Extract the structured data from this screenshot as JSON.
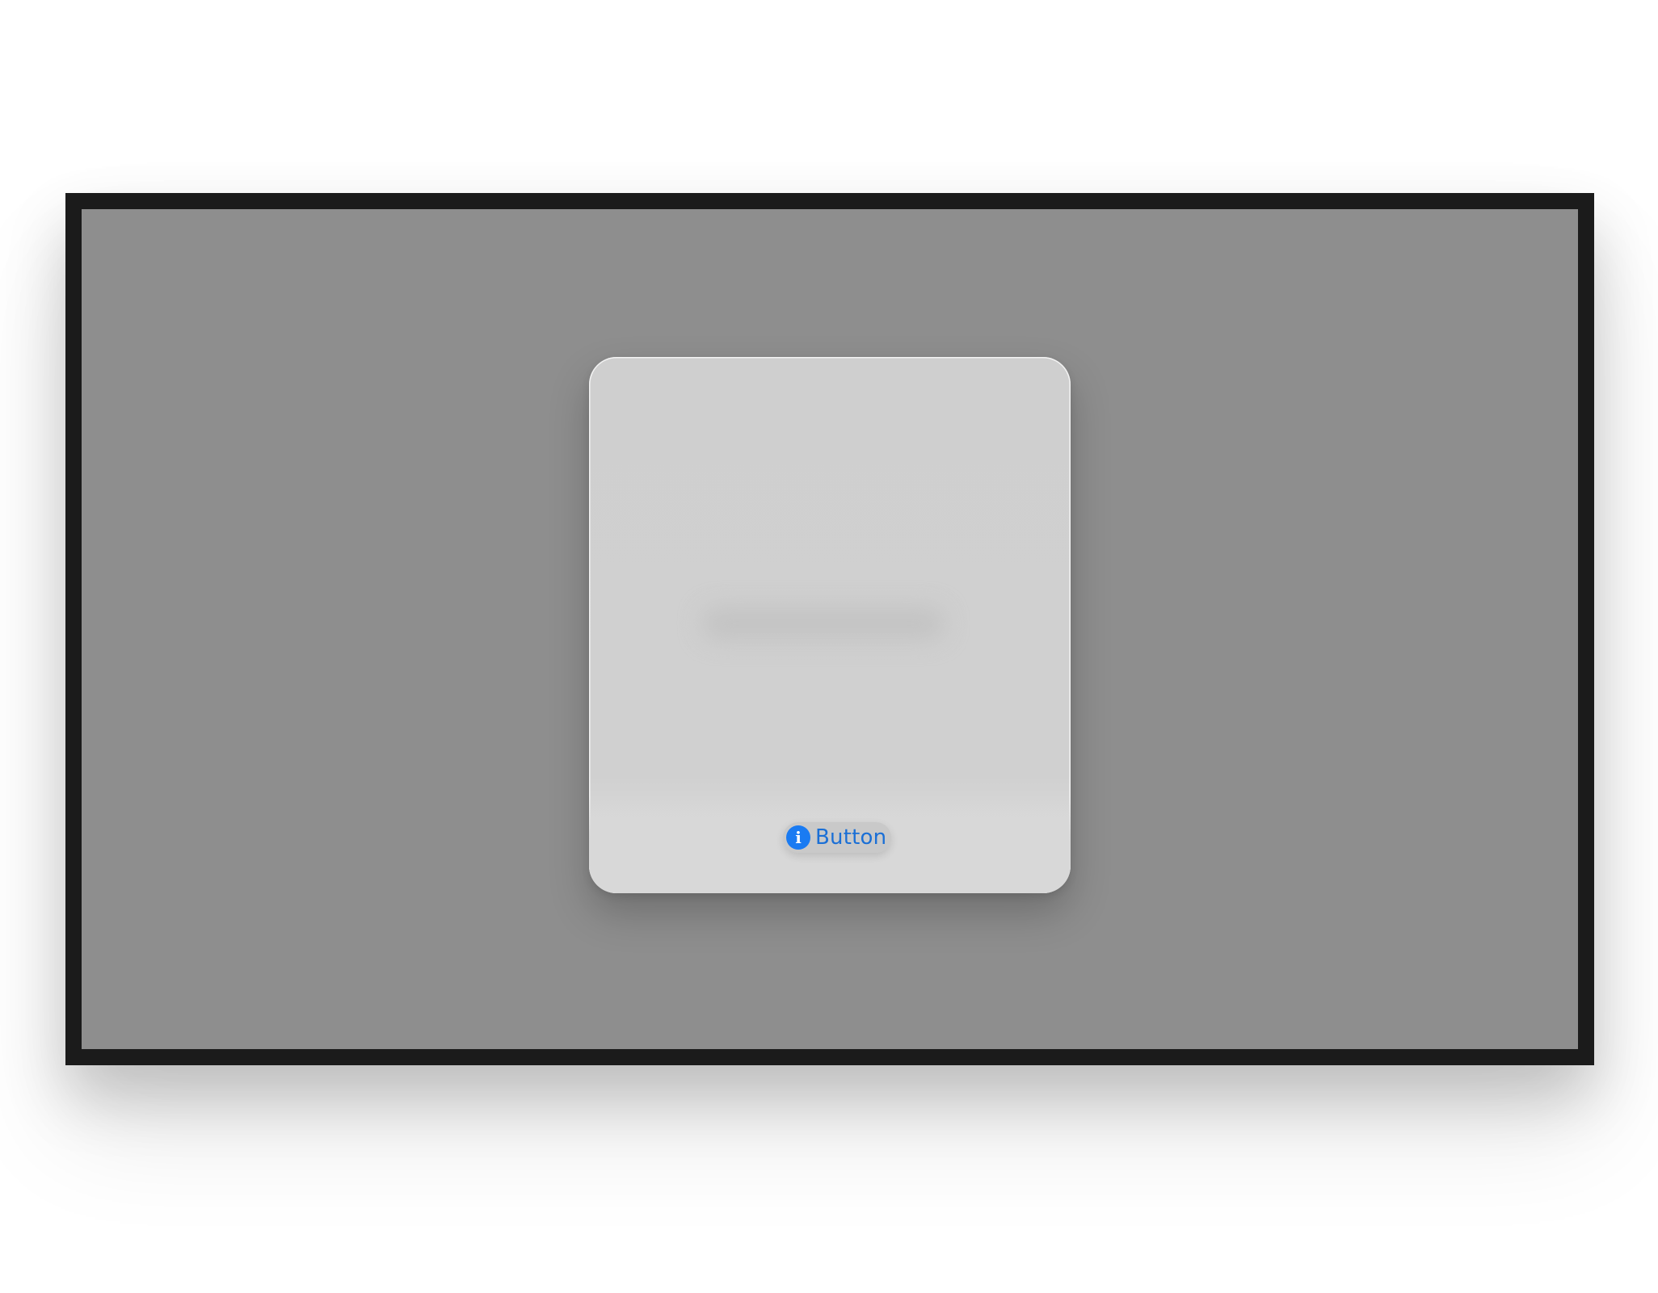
{
  "card": {
    "button": {
      "icon": "info-circle-icon",
      "icon_glyph": "i",
      "label": "Button"
    }
  },
  "colors": {
    "accent": "#1a7bf2",
    "screen_background": "#8e8e8e",
    "card_background": "#d0d0d0",
    "frame": "#1b1b1b"
  }
}
